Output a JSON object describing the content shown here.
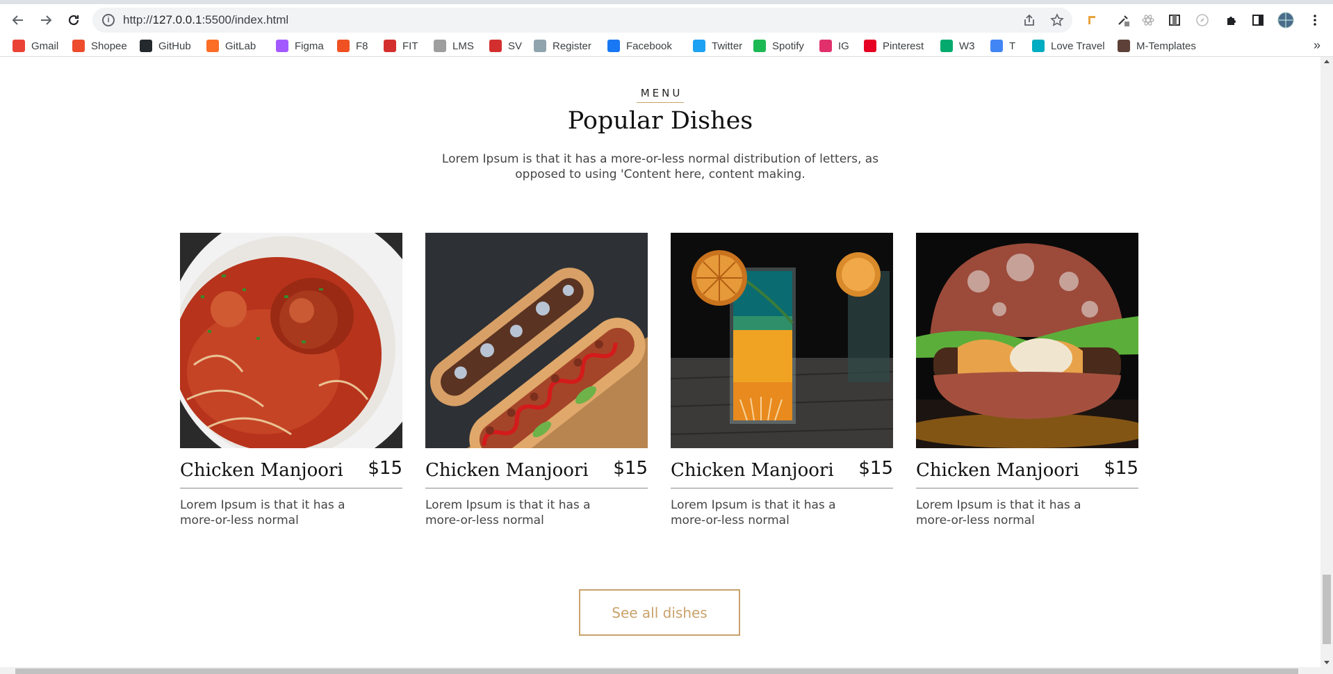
{
  "browser": {
    "url_prefix": "http://",
    "url_host": "127.0.0.1",
    "url_rest": ":5500/index.html",
    "bookmarks": [
      {
        "label": "Gmail",
        "icon": "gmail-icon",
        "color": "#ea4335"
      },
      {
        "label": "Shopee",
        "icon": "shopee-icon",
        "color": "#ee4d2d"
      },
      {
        "label": "GitHub",
        "icon": "github-icon",
        "color": "#24292e"
      },
      {
        "label": "GitLab",
        "icon": "gitlab-icon",
        "color": "#fc6d26"
      },
      {
        "label": "Figma",
        "icon": "figma-icon",
        "color": "#a259ff"
      },
      {
        "label": "F8",
        "icon": "f8-icon",
        "color": "#f05123"
      },
      {
        "label": "FIT",
        "icon": "fit-icon",
        "color": "#d32f2f"
      },
      {
        "label": "LMS",
        "icon": "lms-icon",
        "color": "#9e9e9e"
      },
      {
        "label": "SV",
        "icon": "sv-icon",
        "color": "#d32f2f"
      },
      {
        "label": "Register",
        "icon": "register-icon",
        "color": "#90a4ae"
      },
      {
        "label": "Facebook",
        "icon": "facebook-icon",
        "color": "#1877f2"
      },
      {
        "label": "Twitter",
        "icon": "twitter-icon",
        "color": "#1da1f2"
      },
      {
        "label": "Spotify",
        "icon": "spotify-icon",
        "color": "#1db954"
      },
      {
        "label": "IG",
        "icon": "instagram-icon",
        "color": "#e1306c"
      },
      {
        "label": "Pinterest",
        "icon": "pinterest-icon",
        "color": "#e60023"
      },
      {
        "label": "W3",
        "icon": "w3-icon",
        "color": "#04aa6d"
      },
      {
        "label": "T",
        "icon": "translate-icon",
        "color": "#4285f4"
      },
      {
        "label": "Love Travel",
        "icon": "love-travel-icon",
        "color": "#00acc1"
      },
      {
        "label": "M-Templates",
        "icon": "m-templates-icon",
        "color": "#5d4037"
      }
    ],
    "more_label": "»"
  },
  "section": {
    "eyebrow": "MENU",
    "title": "Popular Dishes",
    "description": "Lorem Ipsum is that it has a more-or-less normal distribution of letters, as opposed to using 'Content here, content making."
  },
  "dishes": [
    {
      "name": "Chicken Manjoori",
      "price": "$15",
      "description": "Lorem Ipsum is that it has a more-or-less normal",
      "image": "spaghetti-meatball-photo"
    },
    {
      "name": "Chicken Manjoori",
      "price": "$15",
      "description": "Lorem Ipsum is that it has a more-or-less normal",
      "image": "hotdogs-photo"
    },
    {
      "name": "Chicken Manjoori",
      "price": "$15",
      "description": "Lorem Ipsum is that it has a more-or-less normal",
      "image": "layered-cocktail-photo"
    },
    {
      "name": "Chicken Manjoori",
      "price": "$15",
      "description": "Lorem Ipsum is that it has a more-or-less normal",
      "image": "burger-photo"
    }
  ],
  "cta": {
    "label": "See all dishes"
  },
  "colors": {
    "accent": "#c9a26b",
    "text": "#111111",
    "muted": "#444444"
  }
}
